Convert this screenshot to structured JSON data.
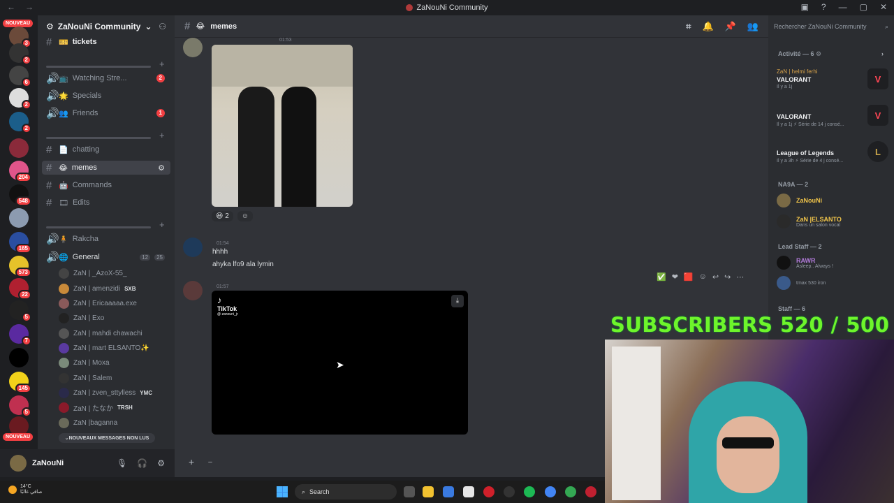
{
  "window": {
    "title": "ZaNouNi Community"
  },
  "servers": {
    "nouveau_label": "NOUVEAU",
    "badges": [
      "3",
      "2",
      "6",
      "2",
      "2",
      "204",
      "548",
      "165",
      "573",
      "22",
      "5",
      "7",
      "145",
      "5"
    ]
  },
  "guild": {
    "name": "ZaNouNi Community"
  },
  "channels": [
    {
      "name": "tickets",
      "emoji": "🎫",
      "type": "text"
    },
    {
      "name": "Watching Stre...",
      "emoji": "📺",
      "type": "voice",
      "count": "2"
    },
    {
      "name": "Specials",
      "emoji": "🌟",
      "type": "voice"
    },
    {
      "name": "Friends",
      "emoji": "👥",
      "type": "voice",
      "count": "1"
    },
    {
      "name": "chatting",
      "emoji": "📄",
      "type": "text"
    },
    {
      "name": "memes",
      "emoji": "😂",
      "type": "text"
    },
    {
      "name": "Commands",
      "emoji": "🤖",
      "type": "text"
    },
    {
      "name": "Edits",
      "emoji": "🎞",
      "type": "text"
    },
    {
      "name": "Rakcha",
      "emoji": "🧍",
      "type": "voice"
    },
    {
      "name": "General",
      "emoji": "🌐",
      "type": "voice",
      "cam": "12",
      "users": "25"
    }
  ],
  "voice_users": [
    {
      "name": "ZaN | _AzoX-55_",
      "tag": ""
    },
    {
      "name": "ZaN | amenzidi",
      "tag": "SXB"
    },
    {
      "name": "ZaN | Ericaaaaa.exe",
      "tag": ""
    },
    {
      "name": "ZaN | Exo",
      "tag": ""
    },
    {
      "name": "ZaN | mahdi chawachi",
      "tag": ""
    },
    {
      "name": "ZaN | mart ELSANTO✨",
      "tag": ""
    },
    {
      "name": "ZaN | Moxa",
      "tag": ""
    },
    {
      "name": "ZaN | Salem",
      "tag": ""
    },
    {
      "name": "ZaN | zven_sttylless",
      "tag": "YMC"
    },
    {
      "name": "ZaN | たなか",
      "tag": "TRSH"
    },
    {
      "name": "ZaN |baganna",
      "tag": ""
    }
  ],
  "new_messages_label": "NOUVEAUX MESSAGES NON LUS",
  "user_panel": {
    "name": "ZaNouNi"
  },
  "main": {
    "channel_title": "memes",
    "first_time": "01:53",
    "reaction_count": "2",
    "message2": {
      "time": "01:54",
      "lines": [
        "hhhh",
        "ahyka lfo9 ala lymin"
      ]
    },
    "message3": {
      "time": "01:57",
      "video_brand": "TikTok",
      "video_handle": "@ zanouni_jr"
    }
  },
  "activity": {
    "search_placeholder": "Rechercher ZaNouNi Community",
    "header": "Activité — 6",
    "cards": [
      {
        "user": "ZaN | helmi ferhi",
        "game": "VALORANT",
        "meta": "Il y a 1j"
      },
      {
        "user": "",
        "game": "VALORANT",
        "meta": "Il y a 1j   ⚡ Série de 14 j consé..."
      },
      {
        "user": "",
        "game": "League of Legends",
        "meta": "Il y a 3h   ⚡ Série de 4 j consé..."
      }
    ],
    "group1": "NA9A — 2",
    "group1_members": [
      {
        "name": "ZaNouNi",
        "sub": ""
      },
      {
        "name": "ZaN |ELSANTO",
        "sub": "Dans un salon vocal"
      }
    ],
    "group2": "Lead Staff — 2",
    "group2_members": [
      {
        "name": "RAWR",
        "sub": "Asleep.. Always !"
      },
      {
        "name": "",
        "sub": "tmax 530 iron"
      }
    ],
    "group3": "Staff — 6"
  },
  "overlay": {
    "subscribers": "SUBSCRIBERS 520 / 500"
  },
  "taskbar": {
    "temp": "14°C",
    "weather_text": "صافي غالبًا",
    "search": "Search"
  }
}
